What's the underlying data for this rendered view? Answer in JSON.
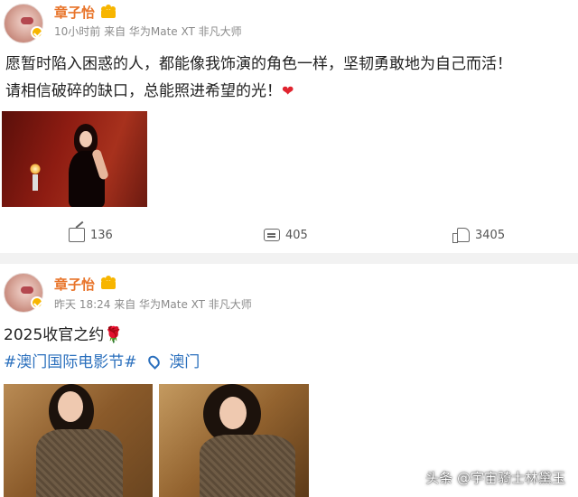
{
  "posts": [
    {
      "author": "章子怡",
      "meta": "10小时前 来自 华为Mate XT 非凡大师",
      "text_lines": [
        "愿暂时陷入困惑的人，都能像我饰演的角色一样，坚韧勇敢地为自己而活！",
        "请相信破碎的缺口，总能照进希望的光！"
      ],
      "emoji": "❤",
      "actions": {
        "share": "136",
        "comment": "405",
        "like": "3405"
      }
    },
    {
      "author": "章子怡",
      "meta": "昨天 18:24 来自 华为Mate XT 非凡大师",
      "text": "2025收官之约🌹",
      "hashtag": "#澳门国际电影节#",
      "location": "澳门"
    }
  ],
  "watermark": "头条 @宇宙骑士林黛玉",
  "colors": {
    "author": "#e8742a",
    "link": "#2a6fbd",
    "heart": "#e0242f",
    "badge": "#f7b500"
  },
  "icons": {
    "share": "share-icon",
    "comment": "comment-icon",
    "like": "like-icon",
    "location": "location-pin-icon",
    "crown": "crown-icon",
    "verified": "verified-badge-icon"
  }
}
